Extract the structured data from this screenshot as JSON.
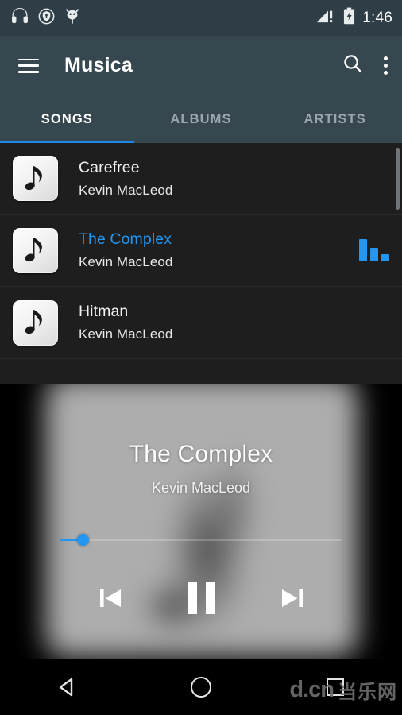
{
  "status_bar": {
    "time": "1:46",
    "left_icons": [
      "headphones-icon",
      "shield-lock-icon",
      "robot-head-icon"
    ],
    "right_icons": [
      "signal-warning-icon",
      "battery-charging-icon"
    ],
    "background_color": "#2f3e46"
  },
  "app_bar": {
    "menu_icon": "hamburger-menu-icon",
    "title": "Musica",
    "search_icon": "search-icon",
    "overflow_icon": "overflow-menu-icon",
    "background_color": "#37474f"
  },
  "tabs": {
    "items": [
      {
        "label": "SONGS",
        "active": true
      },
      {
        "label": "ALBUMS",
        "active": false
      },
      {
        "label": "ARTISTS",
        "active": false
      }
    ],
    "indicator_color": "#1e88e5"
  },
  "song_list": {
    "rows": [
      {
        "title": "Carefree",
        "artist": "Kevin MacLeod",
        "playing": false,
        "art_icon": "music-note-icon"
      },
      {
        "title": "The Complex",
        "artist": "Kevin MacLeod",
        "playing": true,
        "art_icon": "music-note-icon"
      },
      {
        "title": "Hitman",
        "artist": "Kevin MacLeod",
        "playing": false,
        "art_icon": "music-note-icon"
      }
    ],
    "playing_color": "#2196f3",
    "background_color": "#1e1e1e"
  },
  "now_playing": {
    "title": "The Complex",
    "artist": "Kevin MacLeod",
    "progress_percent": 6,
    "seek_color": "#2196f3",
    "controls": {
      "previous": "previous-track-icon",
      "play_pause": "pause-icon",
      "next": "next-track-icon"
    }
  },
  "nav_bar": {
    "back": "back-triangle-icon",
    "home": "home-circle-icon",
    "recents": "recents-square-icon",
    "watermark": {
      "main": "d.cn",
      "cn": "当乐网"
    }
  }
}
